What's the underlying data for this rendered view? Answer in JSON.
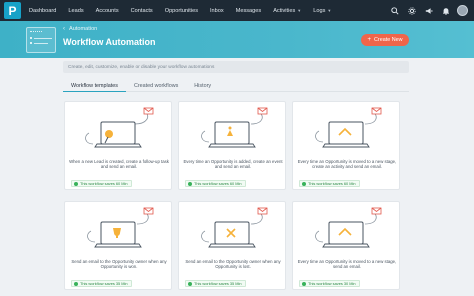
{
  "nav": {
    "logo_letter": "P",
    "items": [
      {
        "label": "Dashboard",
        "has_caret": false
      },
      {
        "label": "Leads",
        "has_caret": false
      },
      {
        "label": "Accounts",
        "has_caret": false
      },
      {
        "label": "Contacts",
        "has_caret": false
      },
      {
        "label": "Opportunities",
        "has_caret": false
      },
      {
        "label": "Inbox",
        "has_caret": false
      },
      {
        "label": "Messages",
        "has_caret": false
      },
      {
        "label": "Activities",
        "has_caret": true
      },
      {
        "label": "Logs",
        "has_caret": true
      }
    ],
    "icons": [
      "search-icon",
      "settings-icon",
      "megaphone-icon",
      "bell-icon",
      "user-avatar"
    ]
  },
  "header": {
    "breadcrumb": "Automation",
    "title": "Workflow Automation",
    "create_button": "Create New"
  },
  "description": "Create, edit, customize, enable or disable your workflow automations",
  "tabs": [
    {
      "label": "Workflow templates",
      "active": true
    },
    {
      "label": "Created workflows",
      "active": false
    },
    {
      "label": "History",
      "active": false
    }
  ],
  "cards": [
    {
      "text": "When a new Lead is created, create a follow-up task and send an email.",
      "badge": "This workflow saves 60 Min",
      "icon": "lead-pin-icon"
    },
    {
      "text": "Every time an Opportunity is added, create an event and send an email.",
      "badge": "This workflow saves 60 Min",
      "icon": "opportunity-icon"
    },
    {
      "text": "Every time an Opportunity is moved to a new stage, create an activity and send an email.",
      "badge": "This workflow saves 60 Min",
      "icon": "stage-icon"
    },
    {
      "text": "Send an email to the Opportunity owner when any Opportunity is won.",
      "badge": "This workflow saves 35 Min",
      "icon": "won-icon"
    },
    {
      "text": "Send an email to the Opportunity owner when any Opportunity is lost.",
      "badge": "This workflow saves 35 Min",
      "icon": "lost-icon"
    },
    {
      "text": "Every time an Opportunity is moved to a new stage, send an email.",
      "badge": "This workflow saves 30 Min",
      "icon": "stage-icon"
    }
  ],
  "colors": {
    "nav_bg": "#1e2a35",
    "banner": "#4ab7cc",
    "accent": "#2aa3bf",
    "create_button": "#f0654a",
    "badge_green": "#38b25a",
    "mail_red": "#e2574c"
  }
}
